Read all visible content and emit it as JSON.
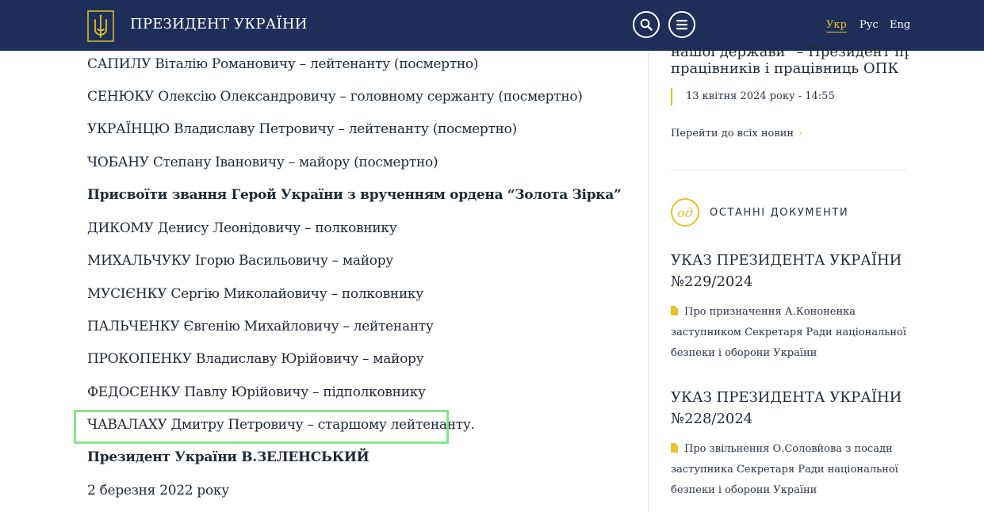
{
  "header": {
    "site_title": "ПРЕЗИДЕНТ УКРАЇНИ",
    "languages": [
      "Укр",
      "Рус",
      "Eng"
    ],
    "active_language": "Укр"
  },
  "main": {
    "lines": [
      "САПИЛУ Віталію Романовичу – лейтенанту (посмертно)",
      "СЕНЮКУ Олексію Олександровичу – головному сержанту (посмертно)",
      "УКРАЇНЦЮ Владиславу Петровичу – лейтенанту (посмертно)",
      "ЧОБАНУ Степану Івановичу – майору (посмертно)",
      "Присвоїти звання Герой України з врученням ордена “Золота Зірка”",
      "ДИКОМУ Денису Леонідовичу – полковнику",
      "МИХАЛЬЧУКУ Ігорю Васильовичу – майору",
      "МУСІЄНКУ Сергію Миколайовичу – полковнику",
      "ПАЛЬЧЕНКУ Євгенію Михайловичу – лейтенанту",
      "ПРОКОПЕНКУ Владиславу Юрійовичу – майору",
      "ФЕДОСЕНКУ Павлу Юрійовичу – підполковнику",
      "ЧАВАЛАХУ Дмитру Петровичу – старшому лейтенанту.",
      "Президент України В.ЗЕЛЕНСЬКИЙ",
      "2 березня 2022 року"
    ]
  },
  "sidebar": {
    "news_title_cut": "нашої держави\" – Президент привітав",
    "news_title_end": "працівників і працівниць ОПК",
    "news_date": "13 квітня 2024 року - 14:55",
    "all_news_link": "Перейти до всіх новин",
    "all_news_chevron": "›",
    "docs_badge": "од",
    "docs_heading": "ОСТАННІ ДОКУМЕНТИ",
    "documents": [
      {
        "title_line1": "УКАЗ ПРЕЗИДЕНТА УКРАЇНИ",
        "title_line2": "№229/2024",
        "description": "Про призначення А.Кононенка заступником Секретаря Ради національної безпеки і оборони України"
      },
      {
        "title_line1": "УКАЗ ПРЕЗИДЕНТА УКРАЇНИ",
        "title_line2": "№228/2024",
        "description": "Про звільнення О.Соловйова з посади заступника Секретаря Ради національної безпеки і оборони України"
      }
    ]
  },
  "colors": {
    "header_bg": "#1d2f58",
    "accent": "#e8bf2a",
    "highlight": "#88e48f"
  }
}
